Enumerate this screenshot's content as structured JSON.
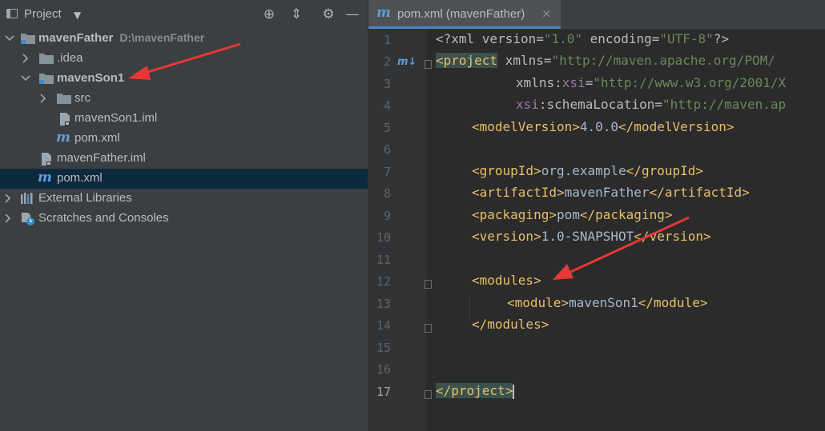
{
  "project_panel": {
    "title": "Project",
    "toolbar_icons": [
      "locate-icon",
      "collapse-icon",
      "gear-icon",
      "minimize-icon"
    ],
    "tree": [
      {
        "label": "mavenFather",
        "path": "D:\\mavenFather",
        "icon": "module-folder-icon",
        "expanded": true
      },
      {
        "label": ".idea",
        "icon": "folder-icon",
        "expanded": false
      },
      {
        "label": "mavenSon1",
        "icon": "module-folder-icon",
        "expanded": true
      },
      {
        "label": "src",
        "icon": "folder-icon",
        "expanded": false
      },
      {
        "label": "mavenSon1.iml",
        "icon": "iml-file-icon"
      },
      {
        "label": "pom.xml",
        "icon": "maven-icon"
      },
      {
        "label": "mavenFather.iml",
        "icon": "iml-file-icon"
      },
      {
        "label": "pom.xml",
        "icon": "maven-icon",
        "selected": true
      },
      {
        "label": "External Libraries",
        "icon": "libraries-icon",
        "expanded": false
      },
      {
        "label": "Scratches and Consoles",
        "icon": "scratches-icon",
        "expanded": false
      }
    ]
  },
  "editor": {
    "tab_label": "pom.xml (mavenFather)",
    "maven_glyph": "m",
    "close_glyph": "×",
    "gutter_marker": "m↓",
    "line_numbers": [
      "1",
      "2",
      "3",
      "4",
      "5",
      "6",
      "7",
      "8",
      "9",
      "10",
      "11",
      "12",
      "13",
      "14",
      "15",
      "16",
      "17"
    ],
    "current_line": "17",
    "lines": {
      "l1": {
        "a": "<?xml version=",
        "b": "\"1.0\"",
        "c": " encoding=",
        "d": "\"UTF-8\"",
        "e": "?>"
      },
      "l2": {
        "tag": "<project",
        "attr": " xmlns=",
        "val": "\"http://maven.apache.org/POM/"
      },
      "l3": {
        "ns": "xmlns:",
        "nsp": "xsi",
        "eq": "=",
        "val": "\"http://www.w3.org/2001/X"
      },
      "l4": {
        "nsp": "xsi",
        "attr": ":schemaLocation=",
        "val": "\"http://maven.ap"
      },
      "l5": {
        "open": "<modelVersion>",
        "text": "4.0.0",
        "close": "</modelVersion>"
      },
      "l7": {
        "open": "<groupId>",
        "text": "org.example",
        "close": "</groupId>"
      },
      "l8": {
        "open": "<artifactId>",
        "text": "mavenFather",
        "close": "</artifactId>"
      },
      "l9": {
        "open": "<packaging>",
        "text": "pom",
        "close": "</packaging>"
      },
      "l10": {
        "open": "<version>",
        "text": "1.0-SNAPSHOT",
        "close": "</version>"
      },
      "l12": {
        "open": "<modules>"
      },
      "l13": {
        "open": "<module>",
        "text": "mavenSon1",
        "close": "</module>"
      },
      "l14": {
        "close": "</modules>"
      },
      "l17": {
        "close": "</project>"
      }
    }
  },
  "colors": {
    "annotation_arrow": "#e53935",
    "selection": "#0d293e",
    "tag": "#e8bf6a",
    "string": "#6a8759"
  }
}
